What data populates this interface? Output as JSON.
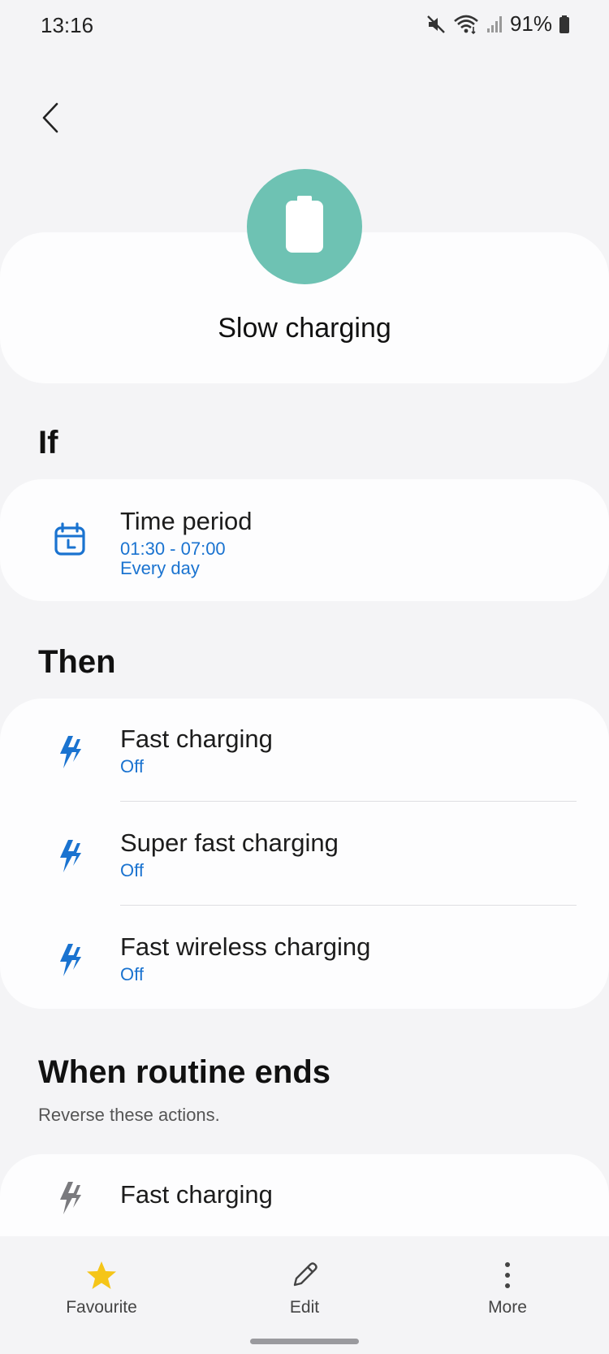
{
  "status_bar": {
    "time": "13:16",
    "battery_percent": "91%",
    "icons": [
      "mute-icon",
      "wifi-icon",
      "signal-icon",
      "battery-icon"
    ]
  },
  "header": {
    "back_icon": "chevron-left-icon",
    "routine_icon": "battery-icon",
    "routine_icon_color": "#6ec2b3",
    "title": "Slow charging"
  },
  "if_section": {
    "heading": "If",
    "items": [
      {
        "icon": "calendar-clock-icon",
        "title": "Time period",
        "sub1": "01:30 - 07:00",
        "sub2": "Every day"
      }
    ]
  },
  "then_section": {
    "heading": "Then",
    "items": [
      {
        "icon": "fast-charging-icon",
        "title": "Fast charging",
        "status": "Off"
      },
      {
        "icon": "fast-charging-icon",
        "title": "Super fast charging",
        "status": "Off"
      },
      {
        "icon": "fast-charging-icon",
        "title": "Fast wireless charging",
        "status": "Off"
      }
    ]
  },
  "end_section": {
    "heading": "When routine ends",
    "subtitle": "Reverse these actions.",
    "items": [
      {
        "icon": "fast-charging-icon",
        "title": "Fast charging"
      }
    ]
  },
  "bottom_nav": {
    "favourite": "Favourite",
    "edit": "Edit",
    "more": "More"
  },
  "colors": {
    "accent": "#1a73d0",
    "favourite_star": "#f5c518",
    "background": "#f4f4f6",
    "card": "#fdfdfe"
  }
}
